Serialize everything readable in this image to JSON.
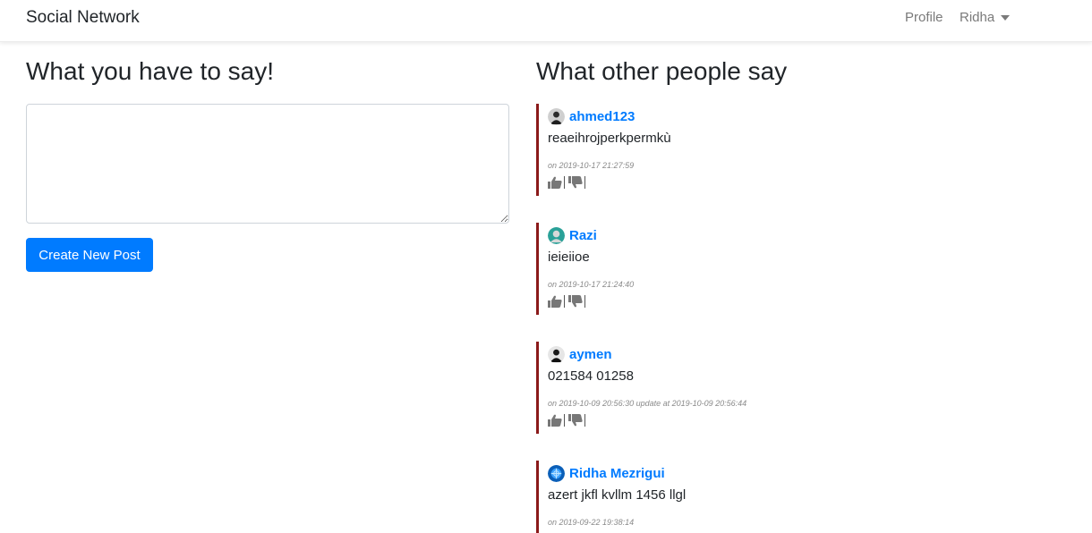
{
  "navbar": {
    "brand": "Social Network",
    "profile_link": "Profile",
    "user_menu": "Ridha"
  },
  "compose": {
    "heading": "What you have to say!",
    "textarea_value": "",
    "button_label": "Create New Post"
  },
  "feed": {
    "heading": "What other people say",
    "posts": [
      {
        "author": "ahmed123",
        "avatar": "person-photo-icon",
        "text": "reaeihrojperkpermkù",
        "meta": "on 2019-10-17 21:27:59"
      },
      {
        "author": "Razi",
        "avatar": "default-user-icon",
        "text": "ieieiioe",
        "meta": "on 2019-10-17 21:24:40"
      },
      {
        "author": "aymen",
        "avatar": "person-photo-icon",
        "text": "021584 01258",
        "meta": "on 2019-10-09 20:56:30 update at 2019-10-09 20:56:44"
      },
      {
        "author": "Ridha Mezrigui",
        "avatar": "globe-icon",
        "text": "azert jkfl kvllm 1456 llgl",
        "meta": "on 2019-09-22 19:38:14"
      }
    ]
  },
  "colors": {
    "accent": "#007bff",
    "post_border": "#8b1a1a",
    "nav_text": "#7a7a7a"
  }
}
